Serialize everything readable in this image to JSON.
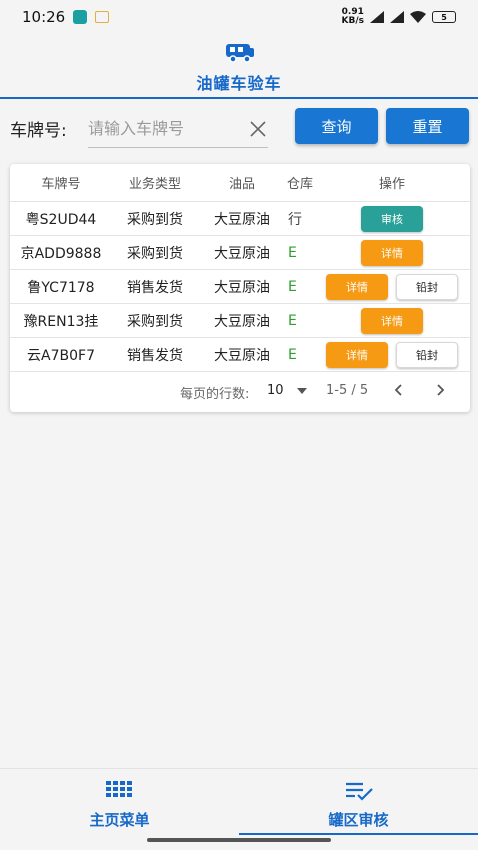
{
  "status_bar": {
    "time": "10:26",
    "net_speed_value": "0.91",
    "net_speed_unit": "KB/s",
    "battery": "5"
  },
  "header": {
    "title": "油罐车验车"
  },
  "search": {
    "label": "车牌号:",
    "placeholder": "请输入车牌号",
    "value": "",
    "query_label": "查询",
    "reset_label": "重置"
  },
  "table": {
    "columns": [
      "车牌号",
      "业务类型",
      "油品",
      "仓库",
      "操作"
    ],
    "rows": [
      {
        "plate": "粤S2UD44",
        "type": "采购到货",
        "oil": "大豆原油",
        "depot": "行",
        "buttons": [
          "审核"
        ]
      },
      {
        "plate": "京ADD9888",
        "type": "采购到货",
        "oil": "大豆原油",
        "depot": "E",
        "buttons": [
          "详情"
        ]
      },
      {
        "plate": "鲁YC7178",
        "type": "销售发货",
        "oil": "大豆原油",
        "depot": "E",
        "buttons": [
          "详情",
          "铅封"
        ]
      },
      {
        "plate": "豫REN13挂",
        "type": "采购到货",
        "oil": "大豆原油",
        "depot": "E",
        "buttons": [
          "详情"
        ]
      },
      {
        "plate": "云A7B0F7",
        "type": "销售发货",
        "oil": "大豆原油",
        "depot": "E",
        "buttons": [
          "详情",
          "铅封"
        ]
      }
    ]
  },
  "pager": {
    "rows_per_page_label": "每页的行数:",
    "rows_per_page": "10",
    "range": "1-5 / 5"
  },
  "bottom_nav": {
    "items": [
      {
        "label": "主页菜单",
        "icon": "grid-icon"
      },
      {
        "label": "罐区审核",
        "icon": "checklist-icon",
        "active": true
      }
    ]
  },
  "colors": {
    "primary": "#1769c9",
    "button_blue": "#1976d2",
    "audit_teal": "#2aa198",
    "detail_orange": "#f59a12",
    "depot_green": "#2e9e2e"
  }
}
